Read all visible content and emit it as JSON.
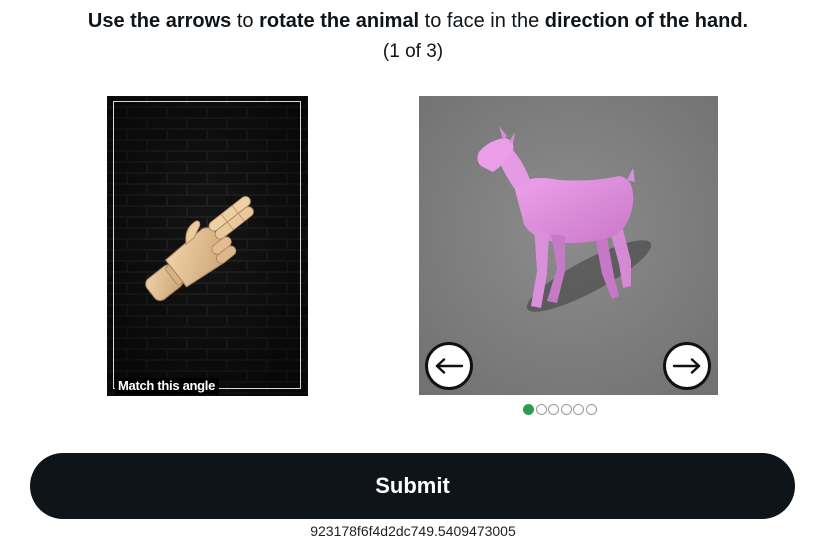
{
  "instruction": {
    "part1_bold": "Use the arrows",
    "part2": " to ",
    "part3_bold": "rotate the animal",
    "part4": " to face in the ",
    "part5_bold": "direction of the hand."
  },
  "progress": "(1 of 3)",
  "reference": {
    "label": "Match this angle",
    "icon": "wooden-hand-pointing"
  },
  "animal": {
    "icon": "pink-goat-3d-model",
    "left_arrow": "←",
    "right_arrow": "→"
  },
  "steps": {
    "total": 6,
    "current": 1
  },
  "submit_label": "Submit",
  "session_id": "923178f6f4d2dc749.5409473005",
  "colors": {
    "button_bg": "#0f1419",
    "dot_active": "#2e9d4f",
    "animal_bg": "#838383",
    "animal_color": "#e08ee0",
    "hand_color": "#e5c196"
  }
}
